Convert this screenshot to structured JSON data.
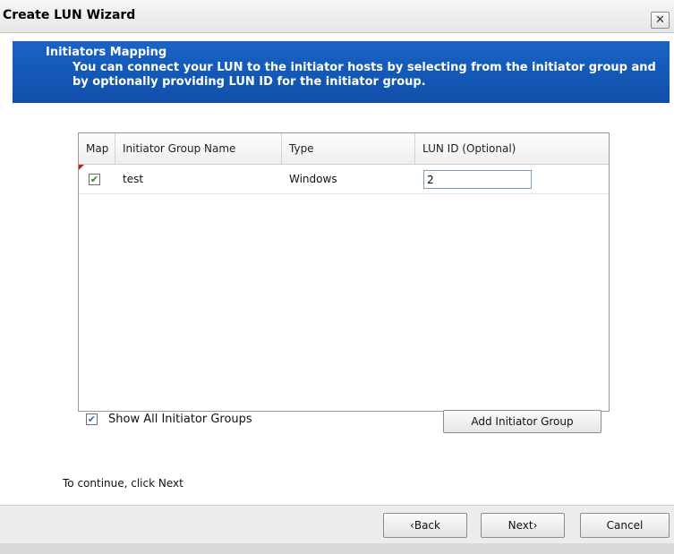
{
  "window": {
    "title": "Create LUN Wizard",
    "close_label": "✕"
  },
  "banner": {
    "title": "Initiators Mapping",
    "description": "You can connect your LUN to the initiator hosts by selecting from the initiator group and by optionally providing LUN ID for the initiator group."
  },
  "table": {
    "headers": {
      "map": "Map",
      "name": "Initiator Group Name",
      "type": "Type",
      "lun_id": "LUN ID (Optional)"
    },
    "rows": [
      {
        "mapped": true,
        "name": "test",
        "type": "Windows",
        "lun_id": "2"
      }
    ]
  },
  "options": {
    "show_all_label": "Show All Initiator Groups",
    "show_all_checked": true
  },
  "buttons": {
    "add_group": "Add Initiator Group",
    "back": "‹Back",
    "next": "Next›",
    "cancel": "Cancel"
  },
  "hint": "To continue, click Next",
  "colors": {
    "banner": "#1259bd",
    "accent_check": "#1a8a2a"
  }
}
